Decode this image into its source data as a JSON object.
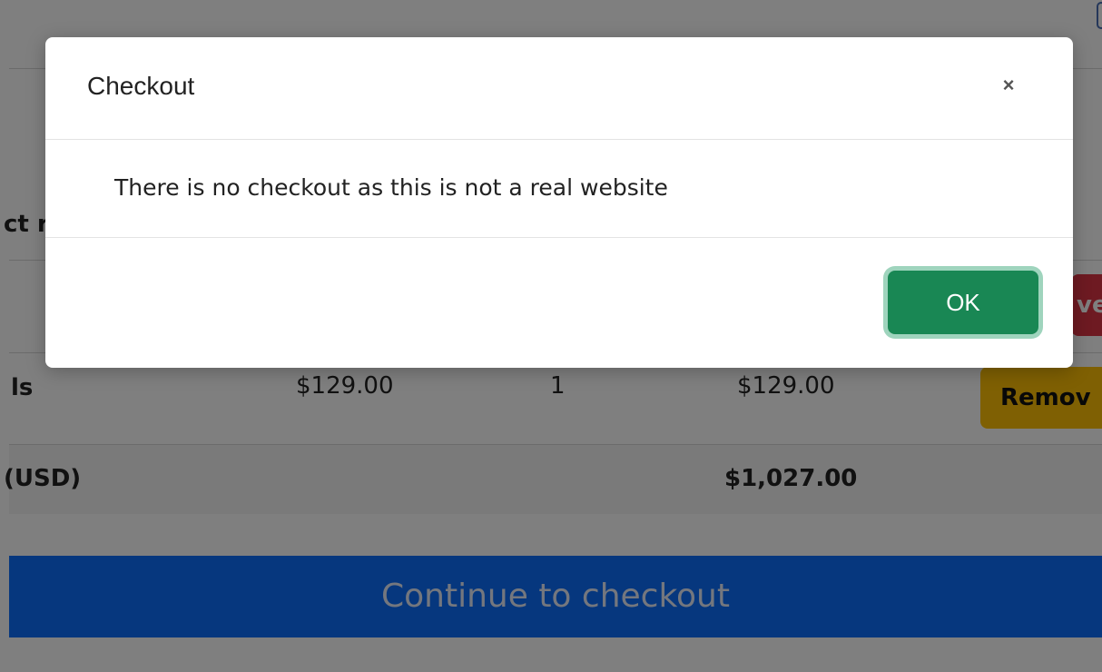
{
  "background_page": {
    "row_partial_label_1": "ct r",
    "row_remove_partial_1": "ve",
    "row2": {
      "name_partial": "ls",
      "price": "$129.00",
      "quantity": "1",
      "subtotal": "$129.00",
      "remove_partial": "Remov"
    },
    "total_label_partial": "(USD)",
    "total_value": "$1,027.00",
    "checkout_button_label": "Continue to checkout"
  },
  "modal": {
    "title": "Checkout",
    "close_symbol": "×",
    "message": "There is no checkout as this is not a real website",
    "ok_label": "OK"
  },
  "colors": {
    "ok_button": "#198754",
    "checkout_button": "#0d6efd",
    "remove_red": "#dc3545",
    "remove_yellow": "#ffc107"
  }
}
